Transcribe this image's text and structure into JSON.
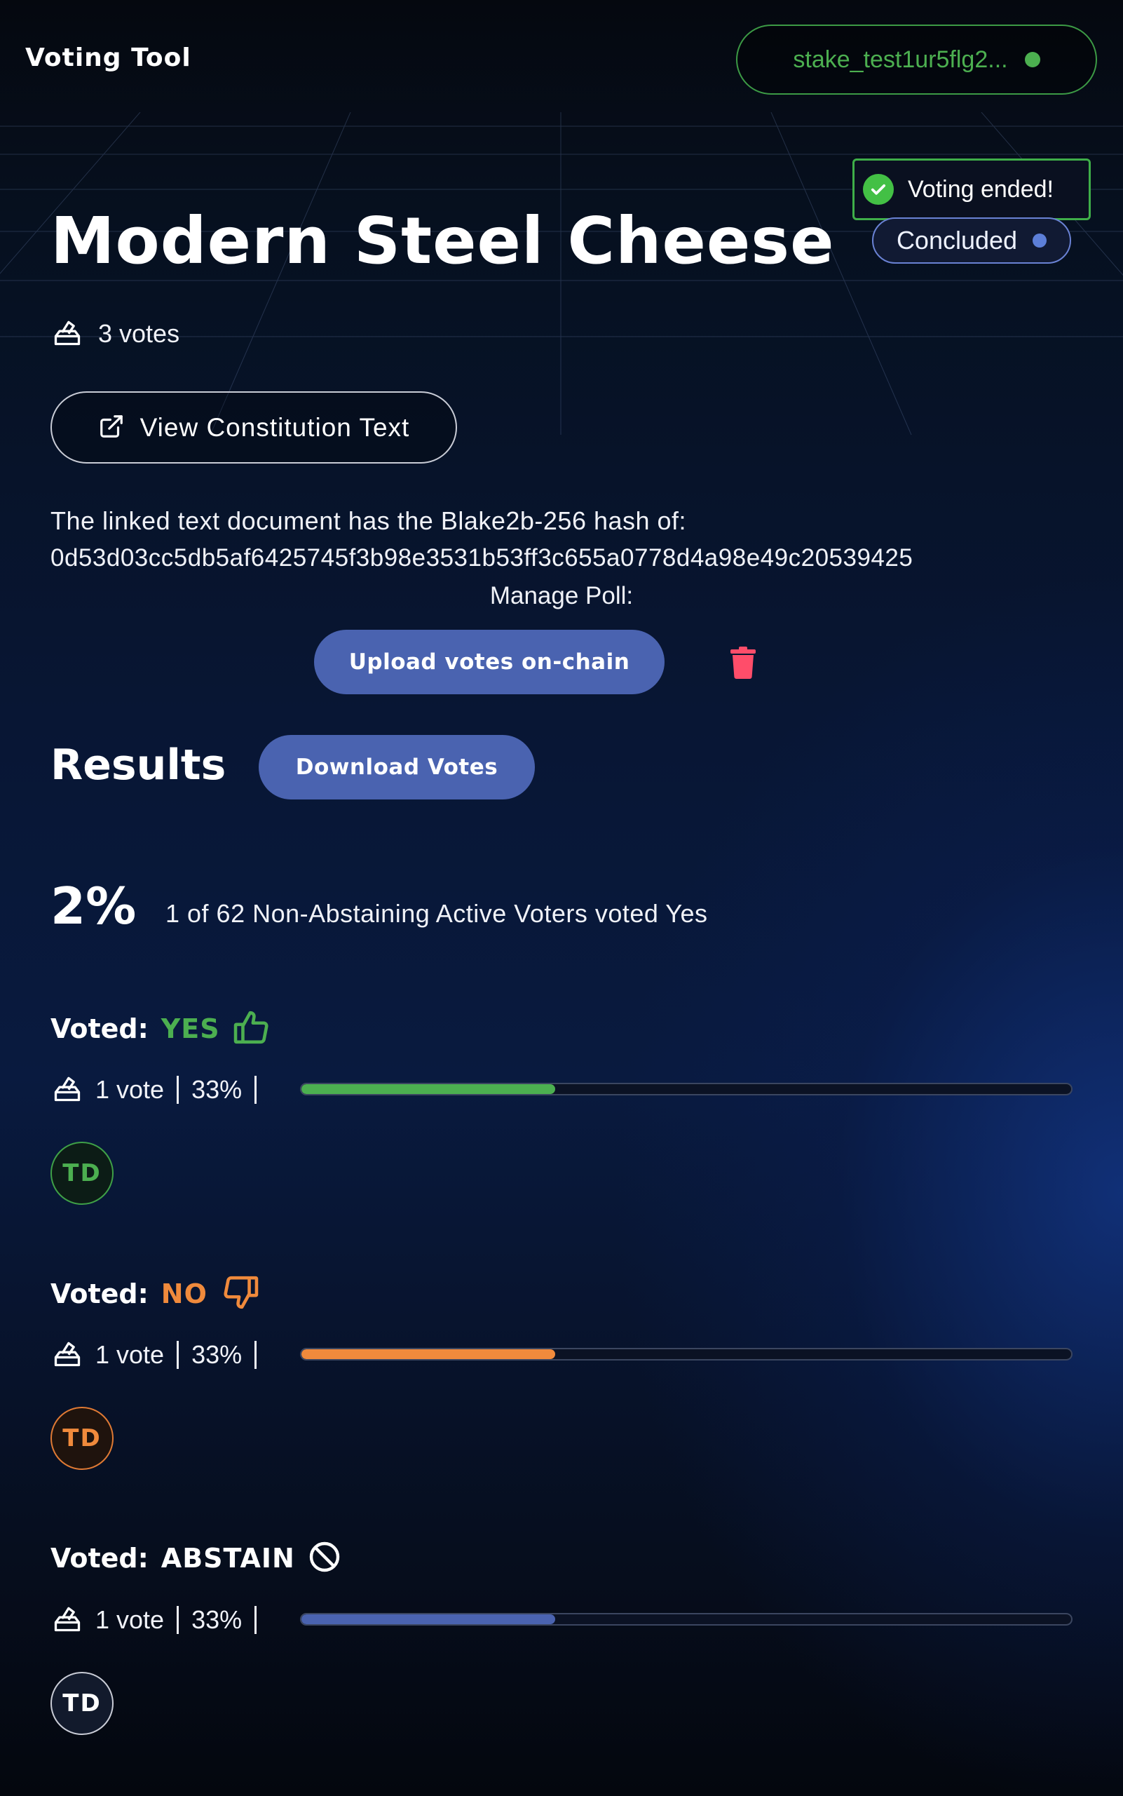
{
  "app": {
    "title": "Voting Tool"
  },
  "wallet": {
    "address": "stake_test1ur5flg2...",
    "status_color": "#4caf50"
  },
  "toast": {
    "message": "Voting ended!"
  },
  "poll": {
    "title": "Modern Steel Cheese",
    "status": "Concluded",
    "votes_text": "3 votes",
    "constitution_button": "View Constitution Text",
    "hash_intro": "The linked text document has the Blake2b-256 hash of:",
    "hash_value": "0d53d03cc5db5af6425745f3b98e3531b53ff3c655a0778d4a98e49c20539425",
    "manage_label": "Manage Poll:",
    "upload_button": "Upload votes on-chain"
  },
  "results": {
    "heading": "Results",
    "download_button": "Download Votes",
    "yes_percent": "2%",
    "summary": "1 of 62 Non-Abstaining Active Voters voted Yes",
    "groups": [
      {
        "label": "Voted:",
        "choice": "YES",
        "count": "1 vote",
        "percent": "33%",
        "fraction": 0.33,
        "color": "#4caf50",
        "avatar": "TD",
        "icon": "thumbs-up-icon"
      },
      {
        "label": "Voted:",
        "choice": "NO",
        "count": "1 vote",
        "percent": "33%",
        "fraction": 0.33,
        "color": "#f08a3c",
        "avatar": "TD",
        "icon": "thumbs-down-icon"
      },
      {
        "label": "Voted:",
        "choice": "ABSTAIN",
        "count": "1 vote",
        "percent": "33%",
        "fraction": 0.33,
        "color": "#4a63b0",
        "avatar": "TD",
        "icon": "abstain-icon"
      }
    ]
  },
  "colors": {
    "accent": "#4a63b0",
    "yes": "#4caf50",
    "no": "#f08a3c",
    "delete": "#ff4d6a"
  }
}
